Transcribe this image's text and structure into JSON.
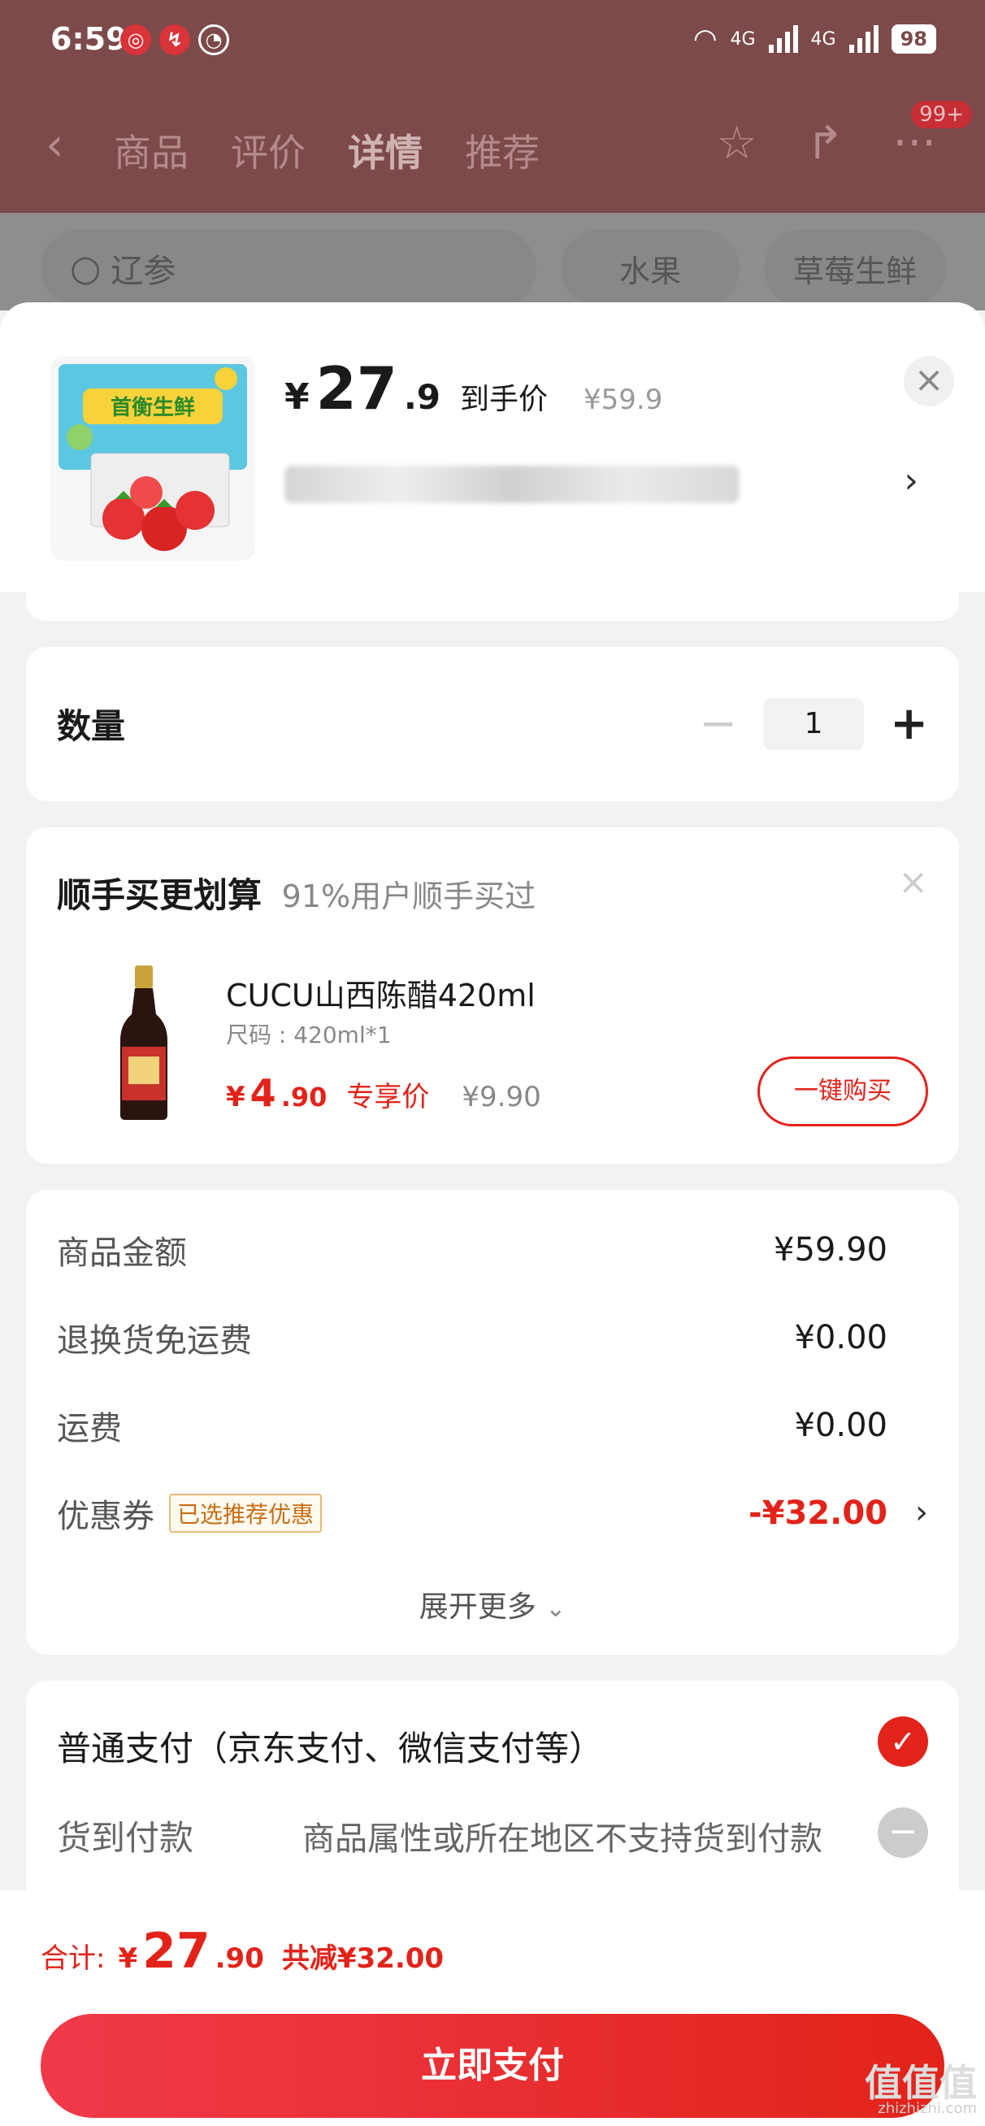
{
  "status_bar": {
    "time": "6:59",
    "net_1": "4G",
    "net_2": "4G",
    "battery": "98"
  },
  "nav": {
    "tabs": [
      {
        "label": "商品"
      },
      {
        "label": "评价"
      },
      {
        "label": "详情"
      },
      {
        "label": "推荐"
      }
    ],
    "badge": "99+"
  },
  "search": {
    "query": "辽参",
    "chips": [
      "水果",
      "草莓生鲜"
    ]
  },
  "product": {
    "thumb_text": "首衡生鲜",
    "currency": "¥",
    "price_int": "27",
    "price_dec": ".9",
    "price_label": "到手价",
    "original_price": "¥59.9"
  },
  "quantity": {
    "label": "数量",
    "value": "1"
  },
  "upsell": {
    "title": "顺手买更划算",
    "subtitle": "91%用户顺手买过",
    "item_name": "CUCU山西陈醋420ml",
    "item_spec": "尺码 : 420ml*1",
    "currency": "¥",
    "price_int": "4",
    "price_dec": ".90",
    "price_label": "专享价",
    "original_price": "¥9.90",
    "buy_label": "一键购买"
  },
  "summary": {
    "rows": [
      {
        "label": "商品金额",
        "value": "¥59.90"
      },
      {
        "label": "退换货免运费",
        "value": "¥0.00"
      },
      {
        "label": "运费",
        "value": "¥0.00"
      },
      {
        "label": "优惠券",
        "tag": "已选推荐优惠",
        "value": "-¥32.00"
      }
    ],
    "more_label": "展开更多"
  },
  "payment": {
    "normal": "普通支付（京东支付、微信支付等）",
    "cod": "货到付款",
    "cod_note": "商品属性或所在地区不支持货到付款"
  },
  "footer": {
    "total_label": "合计:",
    "currency": "¥",
    "total_int": "27",
    "total_dec": ".90",
    "saved": "共减¥32.00",
    "pay_button": "立即支付"
  },
  "watermark": {
    "text": "值值值",
    "sub": "zhizhizhi.com"
  },
  "colors": {
    "accent": "#e2231a",
    "coupon_tag": "#c76d14"
  }
}
